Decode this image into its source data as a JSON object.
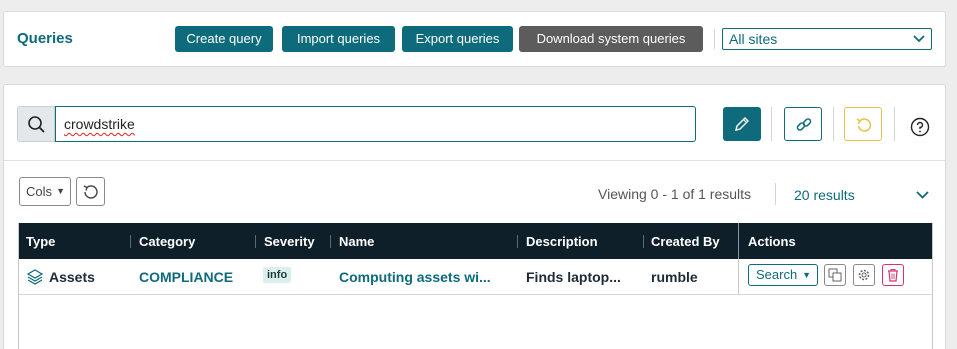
{
  "header": {
    "title": "Queries",
    "buttons": {
      "create": "Create query",
      "import": "Import queries",
      "export": "Export queries",
      "download_system": "Download system queries"
    },
    "site_select": "All sites"
  },
  "search": {
    "value": "crowdstrike"
  },
  "toolbar": {
    "cols_label": "Cols",
    "viewing_text": "Viewing 0 - 1 of 1 results",
    "per_page": "20 results"
  },
  "table": {
    "columns": [
      "Type",
      "Category",
      "Severity",
      "Name",
      "Description",
      "Created By",
      "Actions"
    ],
    "rows": [
      {
        "type": "Assets",
        "category": "COMPLIANCE",
        "severity": "info",
        "name": "Computing assets wi...",
        "description": "Finds laptop...",
        "created_by": "rumble",
        "action_label": "Search"
      }
    ]
  },
  "colors": {
    "accent": "#0e6b7c",
    "header_bg": "#0f1f29",
    "delete": "#d6336c",
    "revert": "#e6c24a"
  }
}
